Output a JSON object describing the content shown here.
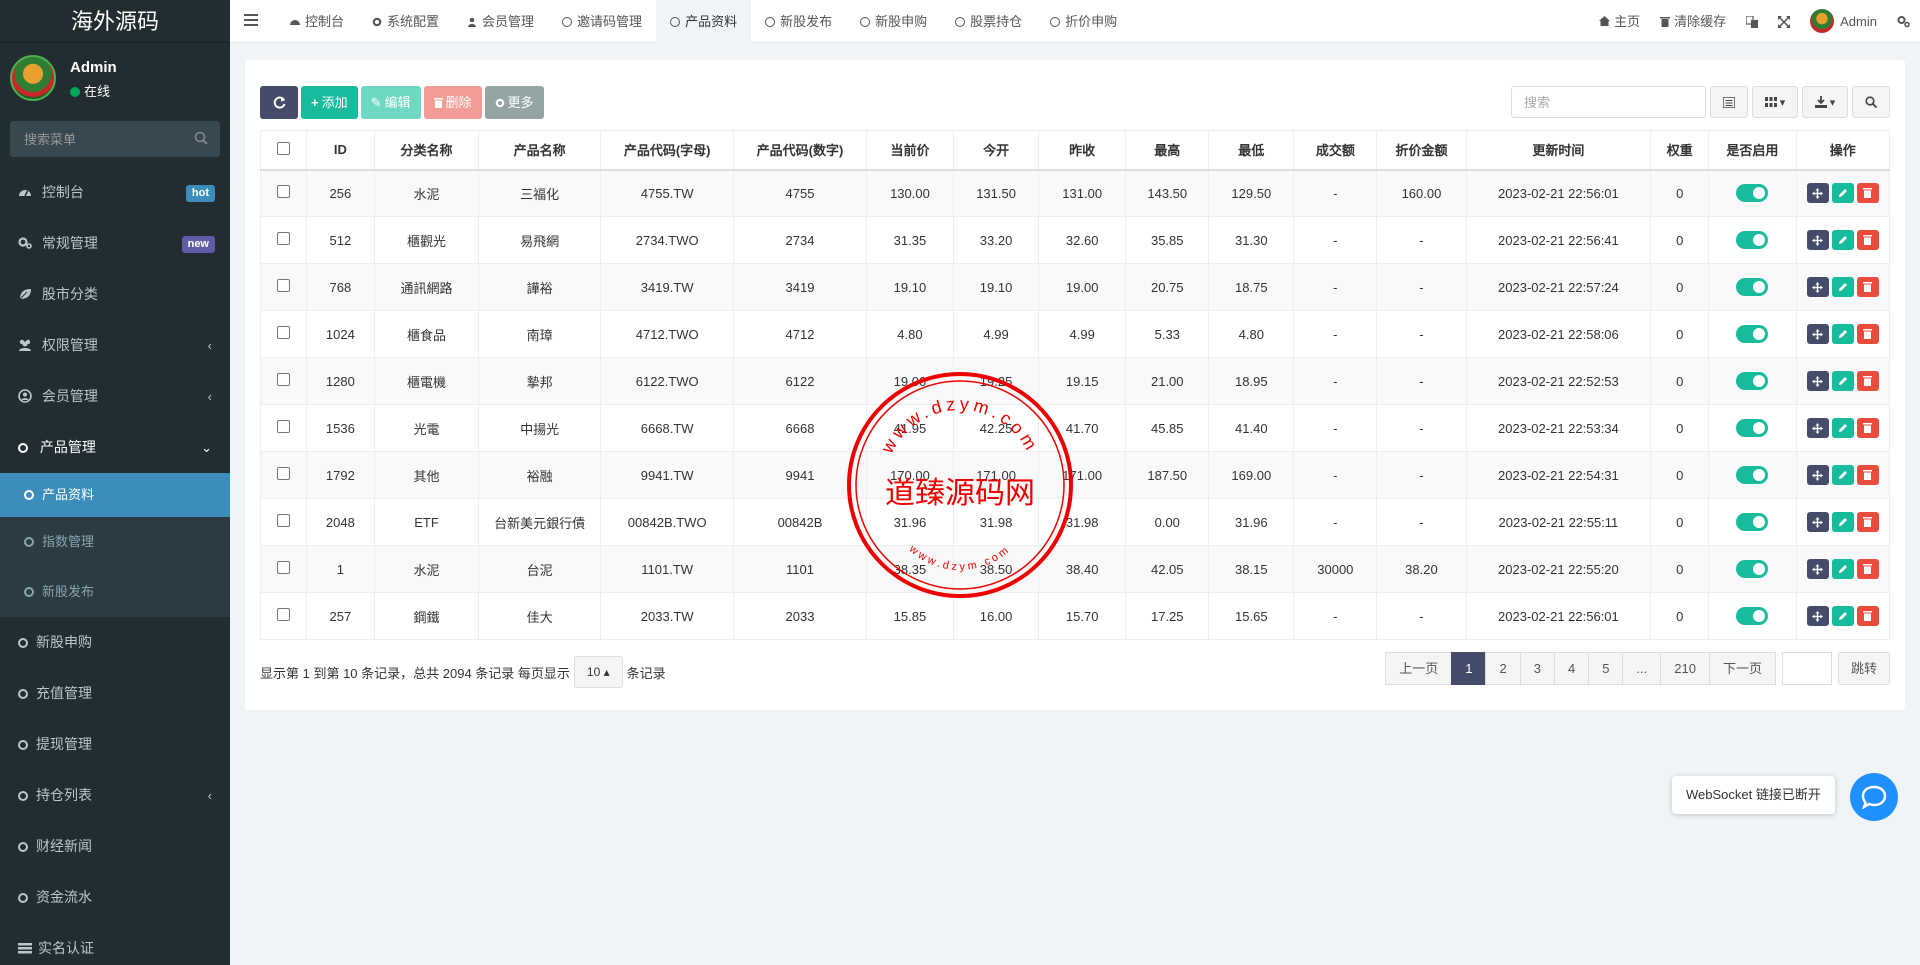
{
  "brand": {
    "title": "海外源码"
  },
  "user": {
    "name": "Admin",
    "status": "在线"
  },
  "sidebar_search": {
    "placeholder": "搜索菜单"
  },
  "menu": {
    "dashboard": "控制台",
    "dashboard_badge": "hot",
    "general": "常规管理",
    "general_badge": "new",
    "market_category": "股市分类",
    "auth": "权限管理",
    "members": "会员管理",
    "products": "产品管理",
    "product_info": "产品资料",
    "index_mgmt": "指数管理",
    "ipo_publish": "新股发布",
    "ipo_subscribe": "新股申购",
    "recharge": "充值管理",
    "withdraw": "提现管理",
    "positions": "持仓列表",
    "news": "财经新闻",
    "fund_flow": "资金流水",
    "kyc": "实名认证"
  },
  "colors": {
    "accent": "#3c8dbc",
    "hot": "#3c8dbc",
    "new": "#605ca8",
    "success": "#18bc9c",
    "danger": "#e74c3c",
    "dark": "#444c69"
  },
  "tabs": [
    "控制台",
    "系统配置",
    "会员管理",
    "邀请码管理",
    "产品资料",
    "新股发布",
    "新股申购",
    "股票持仓",
    "折价申购"
  ],
  "topright": {
    "home": "主页",
    "clear_cache": "清除缓存",
    "admin": "Admin"
  },
  "toolbar": {
    "add": "添加",
    "edit": "编辑",
    "delete": "删除",
    "more": "更多"
  },
  "table_search": {
    "placeholder": "搜索"
  },
  "columns": [
    "ID",
    "分类名称",
    "产品名称",
    "产品代码(字母)",
    "产品代码(数字)",
    "当前价",
    "今开",
    "昨收",
    "最高",
    "最低",
    "成交额",
    "折价金额",
    "更新时间",
    "权重",
    "是否启用",
    "操作"
  ],
  "rows": [
    [
      "256",
      "水泥",
      "三福化",
      "4755.TW",
      "4755",
      "130.00",
      "131.50",
      "131.00",
      "143.50",
      "129.50",
      "-",
      "160.00",
      "2023-02-21 22:56:01",
      "0"
    ],
    [
      "512",
      "櫃觀光",
      "易飛網",
      "2734.TWO",
      "2734",
      "31.35",
      "33.20",
      "32.60",
      "35.85",
      "31.30",
      "-",
      "-",
      "2023-02-21 22:56:41",
      "0"
    ],
    [
      "768",
      "通訊網路",
      "譁裕",
      "3419.TW",
      "3419",
      "19.10",
      "19.10",
      "19.00",
      "20.75",
      "18.75",
      "-",
      "-",
      "2023-02-21 22:57:24",
      "0"
    ],
    [
      "1024",
      "櫃食品",
      "南璋",
      "4712.TWO",
      "4712",
      "4.80",
      "4.99",
      "4.99",
      "5.33",
      "4.80",
      "-",
      "-",
      "2023-02-21 22:58:06",
      "0"
    ],
    [
      "1280",
      "櫃電機",
      "摯邦",
      "6122.TWO",
      "6122",
      "19.00",
      "19.25",
      "19.15",
      "21.00",
      "18.95",
      "-",
      "-",
      "2023-02-21 22:52:53",
      "0"
    ],
    [
      "1536",
      "光電",
      "中揚光",
      "6668.TW",
      "6668",
      "41.95",
      "42.25",
      "41.70",
      "45.85",
      "41.40",
      "-",
      "-",
      "2023-02-21 22:53:34",
      "0"
    ],
    [
      "1792",
      "其他",
      "裕融",
      "9941.TW",
      "9941",
      "170.00",
      "171.00",
      "171.00",
      "187.50",
      "169.00",
      "-",
      "-",
      "2023-02-21 22:54:31",
      "0"
    ],
    [
      "2048",
      "ETF",
      "台新美元銀行債",
      "00842B.TWO",
      "00842B",
      "31.96",
      "31.98",
      "31.98",
      "0.00",
      "31.96",
      "-",
      "-",
      "2023-02-21 22:55:11",
      "0"
    ],
    [
      "1",
      "水泥",
      "台泥",
      "1101.TW",
      "1101",
      "38.35",
      "38.50",
      "38.40",
      "42.05",
      "38.15",
      "30000",
      "38.20",
      "2023-02-21 22:55:20",
      "0"
    ],
    [
      "257",
      "鋼鐵",
      "佳大",
      "2033.TW",
      "2033",
      "15.85",
      "16.00",
      "15.70",
      "17.25",
      "15.65",
      "-",
      "-",
      "2023-02-21 22:56:01",
      "0"
    ]
  ],
  "pagination": {
    "info_prefix": "显示第 1 到第 10 条记录，总共 2094 条记录 每页显示",
    "page_size": "10",
    "info_suffix": "条记录",
    "prev": "上一页",
    "pages": [
      "1",
      "2",
      "3",
      "4",
      "5",
      "...",
      "210"
    ],
    "next": "下一页",
    "jump": "跳转"
  },
  "watermark": {
    "text": "道臻源码网",
    "ring_text": "www.dzym.com"
  },
  "websocket": {
    "status": "WebSocket 链接已断开"
  }
}
